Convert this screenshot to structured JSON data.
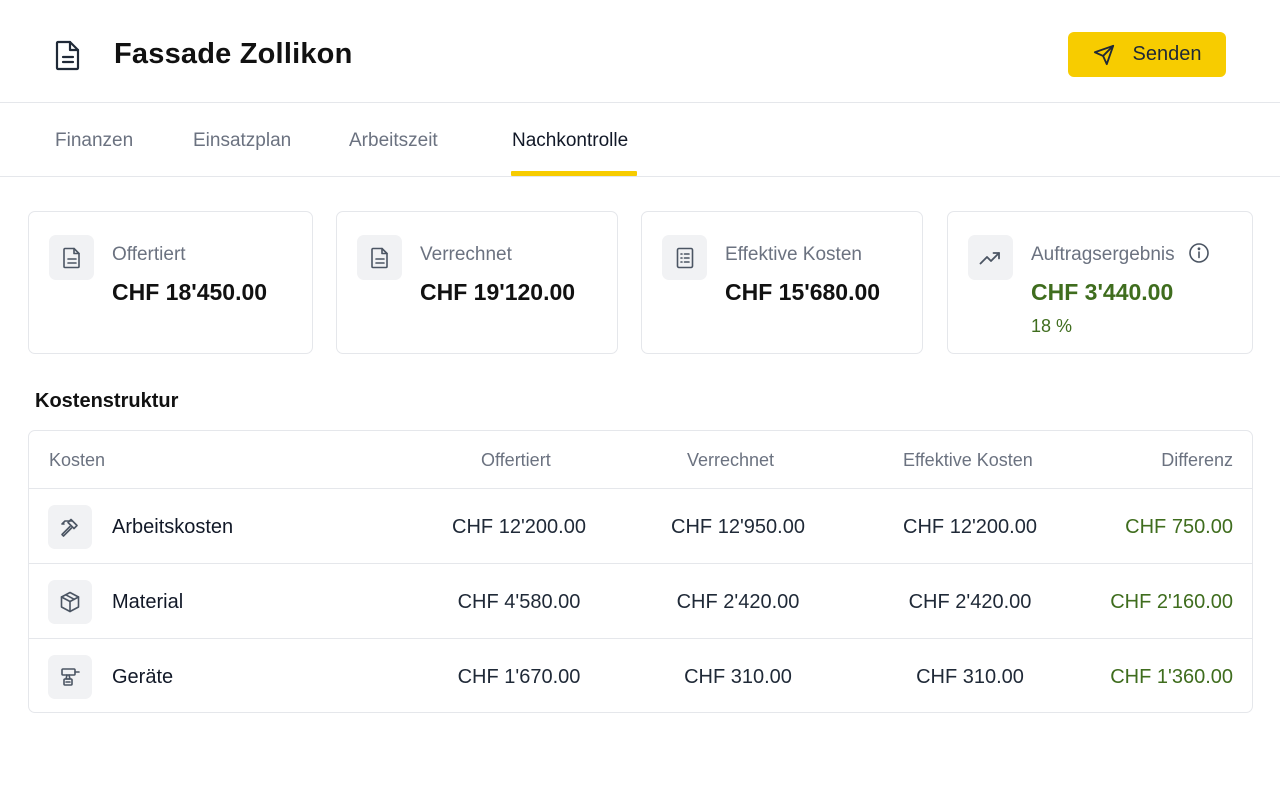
{
  "header": {
    "title": "Fassade Zollikon",
    "send_label": "Senden"
  },
  "tabs": [
    {
      "label": "Finanzen",
      "active": false
    },
    {
      "label": "Einsatzplan",
      "active": false
    },
    {
      "label": "Arbeitszeit",
      "active": false
    },
    {
      "label": "Nachkontrolle",
      "active": true
    }
  ],
  "cards": [
    {
      "icon": "document-icon",
      "label": "Offertiert",
      "value": "CHF 18'450.00"
    },
    {
      "icon": "document-icon",
      "label": "Verrechnet",
      "value": "CHF 19'120.00"
    },
    {
      "icon": "checklist-icon",
      "label": "Effektive Kosten",
      "value": "CHF 15'680.00"
    },
    {
      "icon": "trending-up-icon",
      "label": "Auftragsergebnis",
      "value": "CHF 3'440.00",
      "percent": "18 %"
    }
  ],
  "section_title": "Kostenstruktur",
  "table": {
    "headers": [
      "Kosten",
      "Offertiert",
      "Verrechnet",
      "Effektive Kosten",
      "Differenz"
    ],
    "rows": [
      {
        "icon": "hammer-icon",
        "name": "Arbeitskosten",
        "offertiert": "CHF 12'200.00",
        "verrechnet": "CHF 12'950.00",
        "effektiv": "CHF 12'200.00",
        "differenz": "CHF 750.00"
      },
      {
        "icon": "box-icon",
        "name": "Material",
        "offertiert": "CHF 4'580.00",
        "verrechnet": "CHF 2'420.00",
        "effektiv": "CHF 2'420.00",
        "differenz": "CHF 2'160.00"
      },
      {
        "icon": "drill-icon",
        "name": "Geräte",
        "offertiert": "CHF 1'670.00",
        "verrechnet": "CHF 310.00",
        "effektiv": "CHF 310.00",
        "differenz": "CHF 1'360.00"
      }
    ]
  },
  "colors": {
    "accent": "#f7cc00",
    "positive": "#3f6d1e",
    "muted_text": "#6b7280",
    "border": "#e5e7eb"
  }
}
